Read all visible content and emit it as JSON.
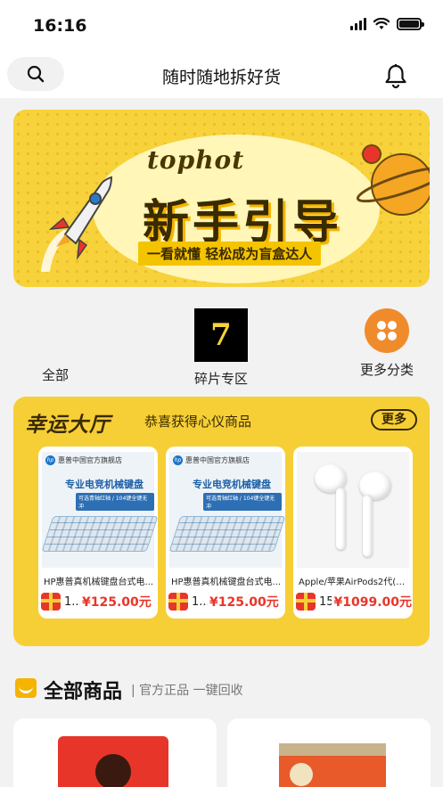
{
  "status_bar": {
    "time": "16:16"
  },
  "header": {
    "title": "随时随地拆好货"
  },
  "banner": {
    "brand": "tophot",
    "title": "新手引导",
    "subtitle": "一看就懂 轻松成为盲盒达人"
  },
  "categories": [
    {
      "label": "全部"
    },
    {
      "label": "碎片专区",
      "badge": "7"
    },
    {
      "label": "更多分类"
    }
  ],
  "lucky_hall": {
    "title": "幸运大厅",
    "subtitle": "恭喜获得心仪商品",
    "more_label": "更多",
    "items": [
      {
        "image_brand": "惠普中国官方旗舰店",
        "image_headline": "专业电竞机械键盘",
        "image_tag": "可选青轴红轴 / 104键全键无冲",
        "name": "HP惠普真机械键盘台式电...",
        "count": "1...",
        "price": "¥125.00元"
      },
      {
        "image_brand": "惠普中国官方旗舰店",
        "image_headline": "专业电竞机械键盘",
        "image_tag": "可选青轴红轴 / 104键全键无冲",
        "name": "HP惠普真机械键盘台式电...",
        "count": "1...",
        "price": "¥125.00元"
      },
      {
        "name": "Apple/苹果AirPods2代(配...",
        "count": "15",
        "price": "¥1099.00元"
      }
    ]
  },
  "all_goods": {
    "title": "全部商品",
    "subtitle": "| 官方正品 一键回收"
  },
  "colors": {
    "accent_yellow": "#f6cf36",
    "price_red": "#e8352a",
    "more_orange": "#f08b2c"
  }
}
